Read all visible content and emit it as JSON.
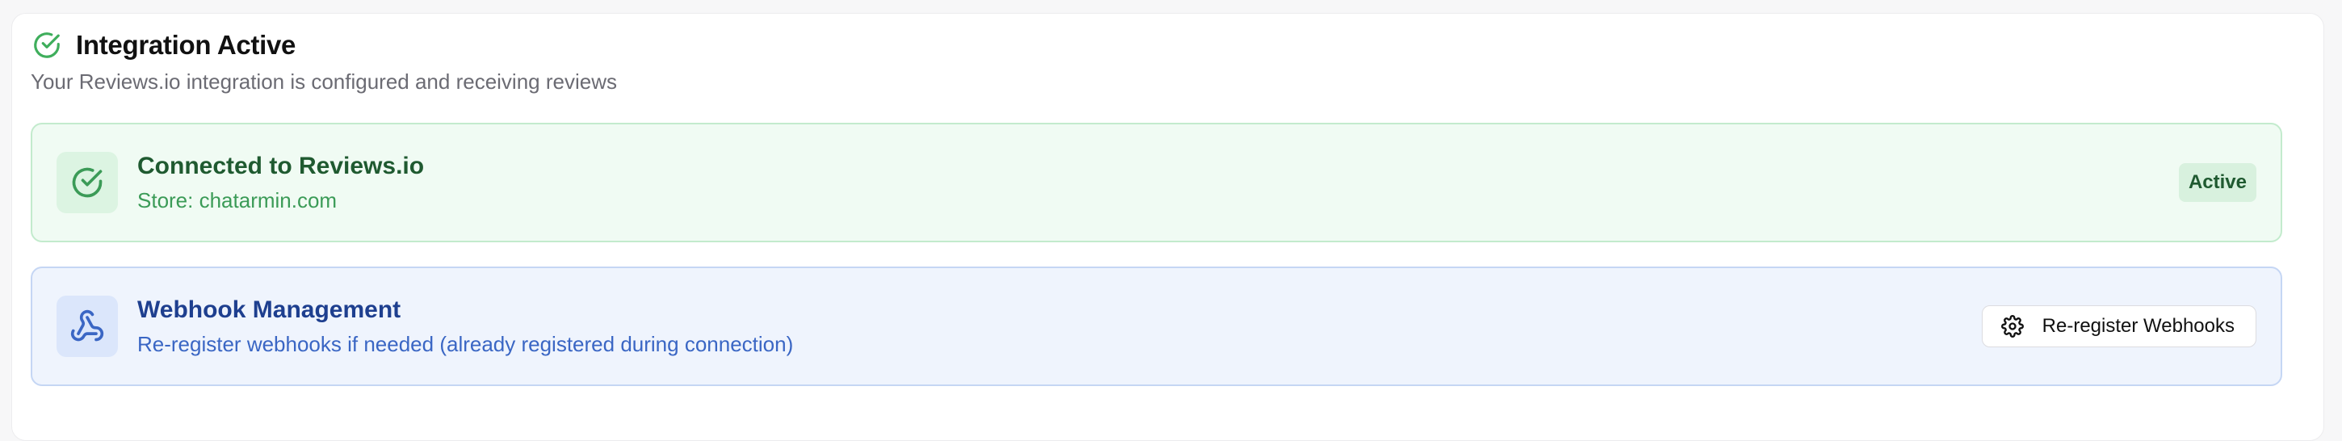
{
  "header": {
    "title": "Integration Active",
    "subtitle": "Your Reviews.io integration is configured and receiving reviews",
    "icon": "check-circle-icon"
  },
  "connection": {
    "title": "Connected to Reviews.io",
    "store": "Store: chatarmin.com",
    "status_badge": "Active",
    "icon": "check-circle-icon",
    "accent_color": "#3b9b57"
  },
  "webhook": {
    "title": "Webhook Management",
    "description": "Re-register webhooks if needed (already registered during connection)",
    "button_label": "Re-register Webhooks",
    "icon": "webhook-icon",
    "button_icon": "gear-icon",
    "accent_color": "#3a66c4"
  }
}
